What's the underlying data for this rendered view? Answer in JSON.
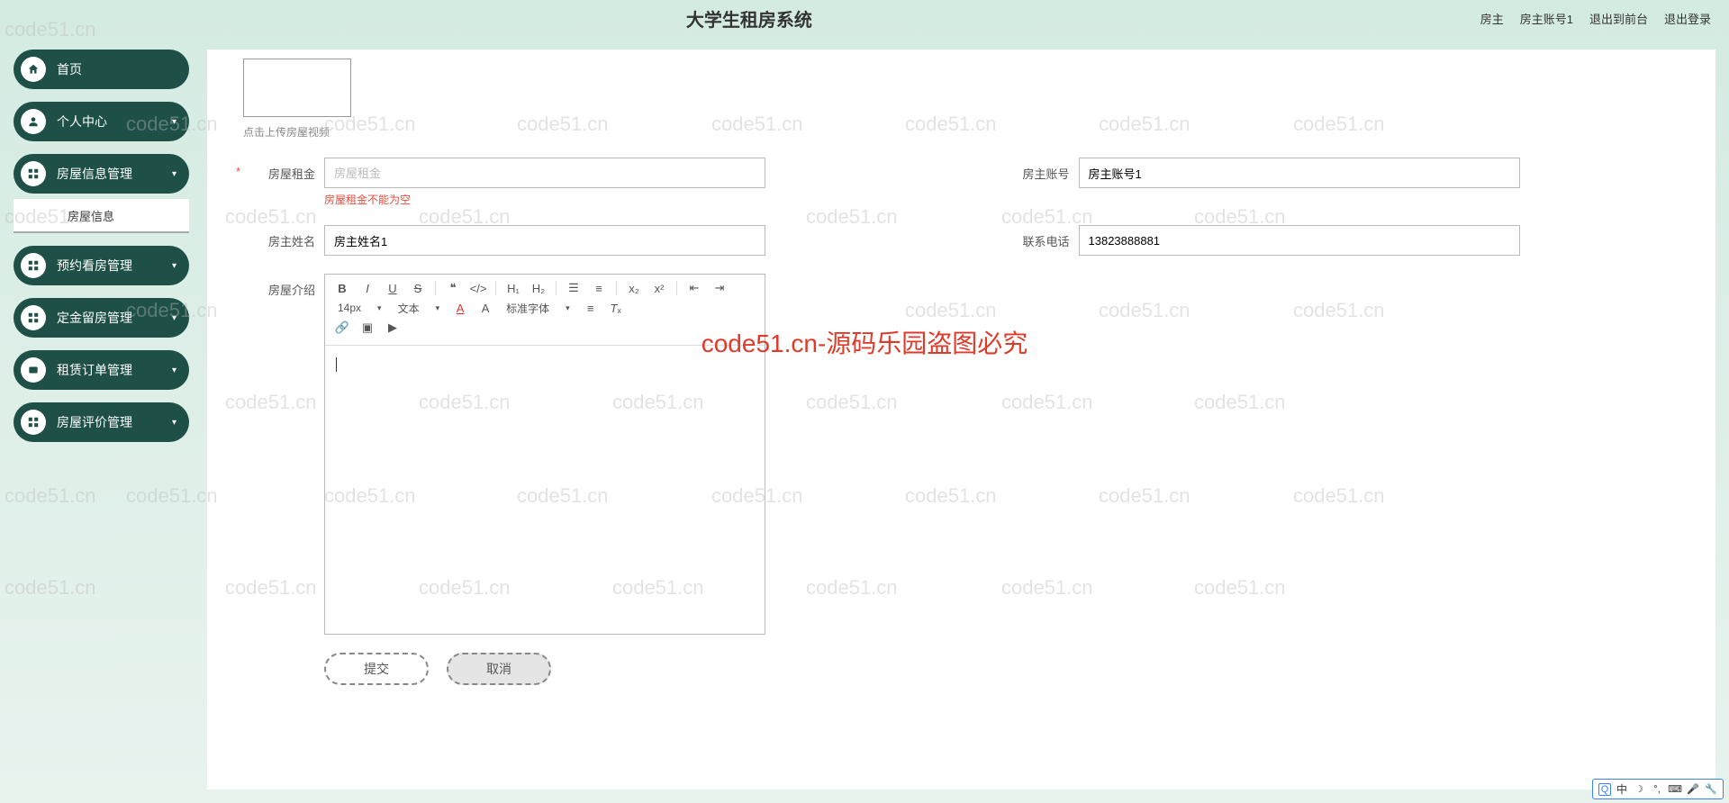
{
  "header": {
    "title": "大学生租房系统",
    "user_role": "房主",
    "user_account": "房主账号1",
    "back_front": "退出到前台",
    "logout": "退出登录"
  },
  "sidebar": {
    "items": [
      {
        "label": "首页",
        "icon": "home",
        "expandable": false
      },
      {
        "label": "个人中心",
        "icon": "user",
        "expandable": true
      },
      {
        "label": "房屋信息管理",
        "icon": "grid",
        "expandable": true,
        "sub": [
          {
            "label": "房屋信息"
          }
        ]
      },
      {
        "label": "预约看房管理",
        "icon": "grid",
        "expandable": true
      },
      {
        "label": "定金留房管理",
        "icon": "grid",
        "expandable": true
      },
      {
        "label": "租赁订单管理",
        "icon": "ticket",
        "expandable": true
      },
      {
        "label": "房屋评价管理",
        "icon": "grid",
        "expandable": true
      }
    ]
  },
  "form": {
    "upload_hint": "点击上传房屋视频",
    "rent_label": "房屋租金",
    "rent_placeholder": "房屋租金",
    "rent_error": "房屋租金不能为空",
    "account_label": "房主账号",
    "account_value": "房主账号1",
    "name_label": "房主姓名",
    "name_value": "房主姓名1",
    "phone_label": "联系电话",
    "phone_value": "13823888881",
    "intro_label": "房屋介绍"
  },
  "editor": {
    "font_size": "14px",
    "font_type": "文本",
    "font_family": "标准字体",
    "tools_row1": [
      "B",
      "I",
      "U",
      "S",
      "❝",
      "</>",
      "H1",
      "H2",
      "list-ol",
      "list-ul",
      "x₂",
      "x²",
      "outdent",
      "indent"
    ],
    "tools_row3": [
      "link",
      "image",
      "video"
    ]
  },
  "buttons": {
    "submit": "提交",
    "cancel": "取消"
  },
  "watermark": {
    "text": "code51.cn",
    "red_text": "code51.cn-源码乐园盗图必究"
  },
  "ime": {
    "lang": "中"
  }
}
